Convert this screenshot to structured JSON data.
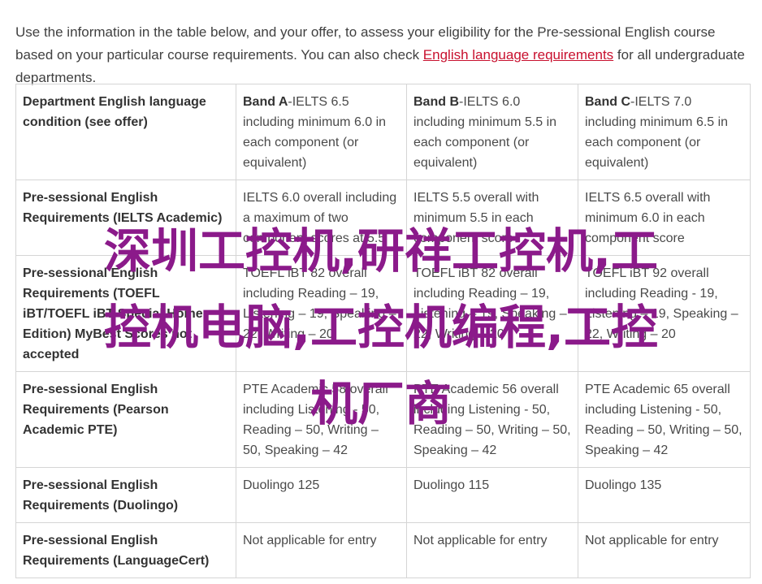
{
  "intro": {
    "text_before": "Use the information in the table below, and your offer, to assess your eligibility for the Pre-sessional English course based on your particular course requirements. You can also check ",
    "link_text": "English language requirements",
    "text_after": " for all undergraduate departments."
  },
  "table": {
    "header": {
      "label": "Department English language condition (see offer)",
      "bands": [
        {
          "name": "Band A",
          "text": "-IELTS 6.5 including minimum 6.0 in each component (or equivalent)"
        },
        {
          "name": "Band B",
          "text": "-IELTS 6.0 including minimum 5.5 in each component (or equivalent)"
        },
        {
          "name": "Band C",
          "text": "-IELTS 7.0 including minimum 6.5 in each component (or equivalent)"
        }
      ]
    },
    "rows": [
      {
        "label": "Pre-sessional English Requirements (IELTS Academic)",
        "cells": [
          "IELTS 6.0 overall including a maximum of two component scores at 5.5",
          "IELTS 5.5 overall with minimum 5.5 in each component score",
          "IELTS 6.5 overall with minimum 6.0 in each component score"
        ]
      },
      {
        "label": "Pre-sessional English Requirements (TOEFL iBT/TOEFL iBT Special Home Edition) MyBest Scores not accepted",
        "cells": [
          "TOEFL iBT 82 overall including Reading – 19, Listening – 19, Speaking – 22, Writing – 20",
          "TOEFL iBT 82 overall including Reading – 19, Listening – 19, Speaking – 22, Writing – 20",
          "TOEFL iBT 92 overall including Reading - 19, Listening – 19, Speaking – 22, Writing – 20"
        ]
      },
      {
        "label": "Pre-sessional English Requirements (Pearson Academic PTE)",
        "cells": [
          "PTE Academic 58 overall including Listening - 50, Reading – 50, Writing – 50, Speaking – 42",
          "PTE Academic 56 overall including Listening - 50, Reading – 50, Writing – 50, Speaking – 42",
          "PTE Academic 65 overall including Listening - 50, Reading – 50, Writing – 50, Speaking – 42"
        ]
      },
      {
        "label": "Pre-sessional English Requirements (Duolingo)",
        "cells": [
          "Duolingo 125",
          "Duolingo 115",
          "Duolingo 135"
        ]
      },
      {
        "label": "Pre-sessional English Requirements (LanguageCert)",
        "cells": [
          "Not applicable for entry",
          "Not applicable for entry",
          "Not applicable for entry"
        ]
      }
    ]
  },
  "watermark": {
    "line1": "深圳工控机,研祥工控机,工",
    "line2": "控机电脑,工控机编程,工控",
    "line3": "机厂商",
    "color": "#8b1a8a"
  },
  "colors": {
    "link": "#c8102e",
    "border": "#d5d5d5",
    "text": "#4a4a4a"
  }
}
